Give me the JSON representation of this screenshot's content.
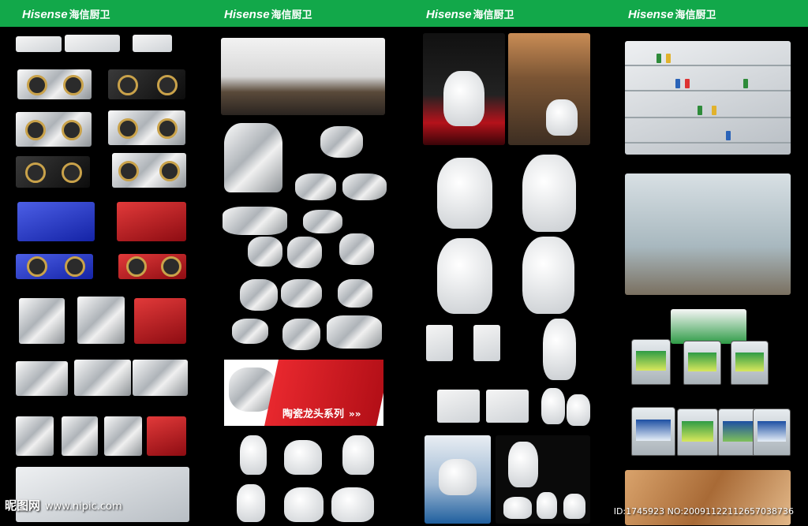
{
  "header": {
    "brand_latin": "Hisense",
    "brand_chinese": "海信厨卫"
  },
  "banner": {
    "text": "陶瓷龙头系列",
    "arrows": "»»"
  },
  "watermark": {
    "site_name": "昵图网",
    "site_url": "www.nipic.com"
  },
  "image_id": "ID:1745923 NO:20091122112657038736",
  "colors": {
    "header_green": "#12a84a",
    "banner_red": "#e8282e",
    "background": "#000000"
  }
}
